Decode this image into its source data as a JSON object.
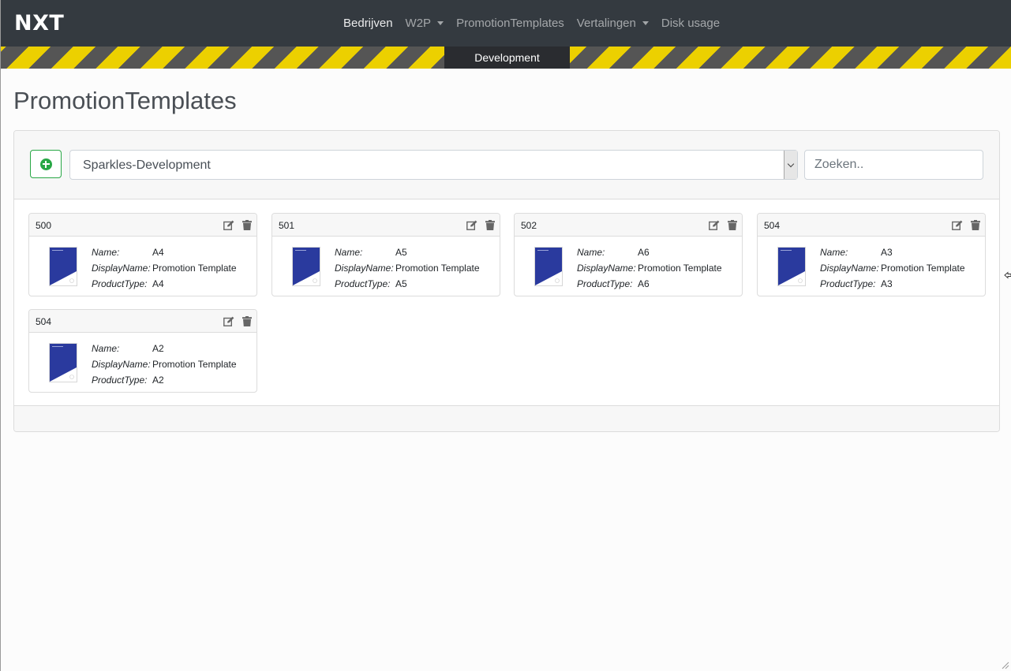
{
  "navbar": {
    "brand": "NXT",
    "items": [
      {
        "label": "Bedrijven",
        "active": true,
        "dropdown": false
      },
      {
        "label": "W2P",
        "active": false,
        "dropdown": true
      },
      {
        "label": "PromotionTemplates",
        "active": false,
        "dropdown": false
      },
      {
        "label": "Vertalingen",
        "active": false,
        "dropdown": true
      },
      {
        "label": "Disk usage",
        "active": false,
        "dropdown": false
      }
    ]
  },
  "environment": {
    "label": "Development",
    "stripe_colors": [
      "#ecd000",
      "#555555"
    ]
  },
  "page": {
    "title": "PromotionTemplates"
  },
  "toolbar": {
    "add_icon": "plus-circle-icon",
    "company_select": {
      "value": "Sparkles-Development"
    },
    "search": {
      "placeholder": "Zoeken.."
    }
  },
  "labels": {
    "name": "Name:",
    "display_name": "DisplayName:",
    "product_type": "ProductType:"
  },
  "templates": [
    {
      "id": "500",
      "name": "A4",
      "display_name": "Promotion Template",
      "product_type": "A4"
    },
    {
      "id": "501",
      "name": "A5",
      "display_name": "Promotion Template",
      "product_type": "A5"
    },
    {
      "id": "502",
      "name": "A6",
      "display_name": "Promotion Template",
      "product_type": "A6"
    },
    {
      "id": "504",
      "name": "A3",
      "display_name": "Promotion Template",
      "product_type": "A3"
    },
    {
      "id": "504",
      "name": "A2",
      "display_name": "Promotion Template",
      "product_type": "A2"
    }
  ],
  "colors": {
    "navbar": "#343a40",
    "add_button": "#28a745",
    "thumbnail_blue": "#2a3a9e"
  }
}
